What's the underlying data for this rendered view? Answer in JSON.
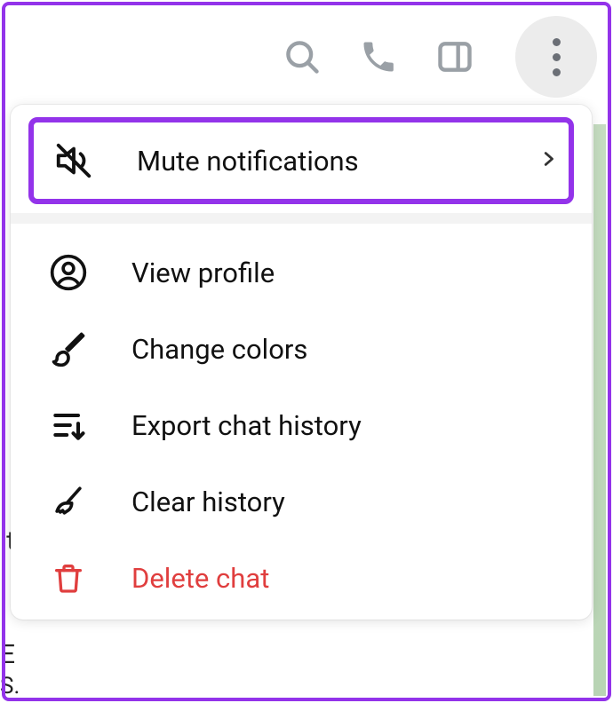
{
  "toolbar": {
    "search": "search",
    "call": "call",
    "sidebar_toggle": "sidebar",
    "more": "more-options"
  },
  "menu": {
    "mute": {
      "label": "Mute notifications"
    },
    "view_profile": {
      "label": "View profile"
    },
    "change_colors": {
      "label": "Change colors"
    },
    "export": {
      "label": "Export chat history"
    },
    "clear": {
      "label": "Clear history"
    },
    "delete": {
      "label": "Delete chat"
    }
  },
  "colors": {
    "highlight": "#9333ea",
    "danger": "#e03e3e"
  }
}
